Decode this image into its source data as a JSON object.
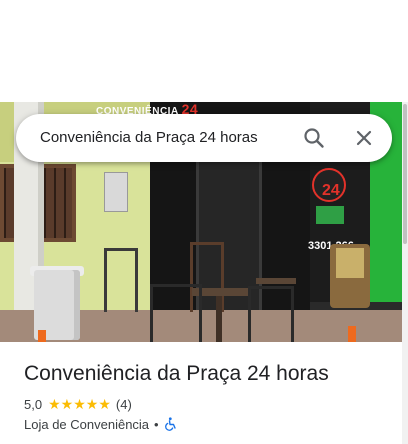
{
  "search": {
    "query": "Conveniência da Praça 24 horas",
    "search_icon": "search-icon",
    "close_icon": "close-icon"
  },
  "photo": {
    "sign_text": "CONVENIÊNCIA",
    "sign_number": "24",
    "logo_number": "24",
    "phone_text": "3301.266"
  },
  "place": {
    "title": "Conveniência da Praça 24 horas",
    "rating": "5,0",
    "stars": 5,
    "review_count": "(4)",
    "category": "Loja de Conveniência",
    "separator": "•",
    "accessibility_icon": "wheelchair-icon"
  },
  "colors": {
    "star": "#fbbc04",
    "accessibility": "#1a73e8",
    "title": "#202124"
  }
}
